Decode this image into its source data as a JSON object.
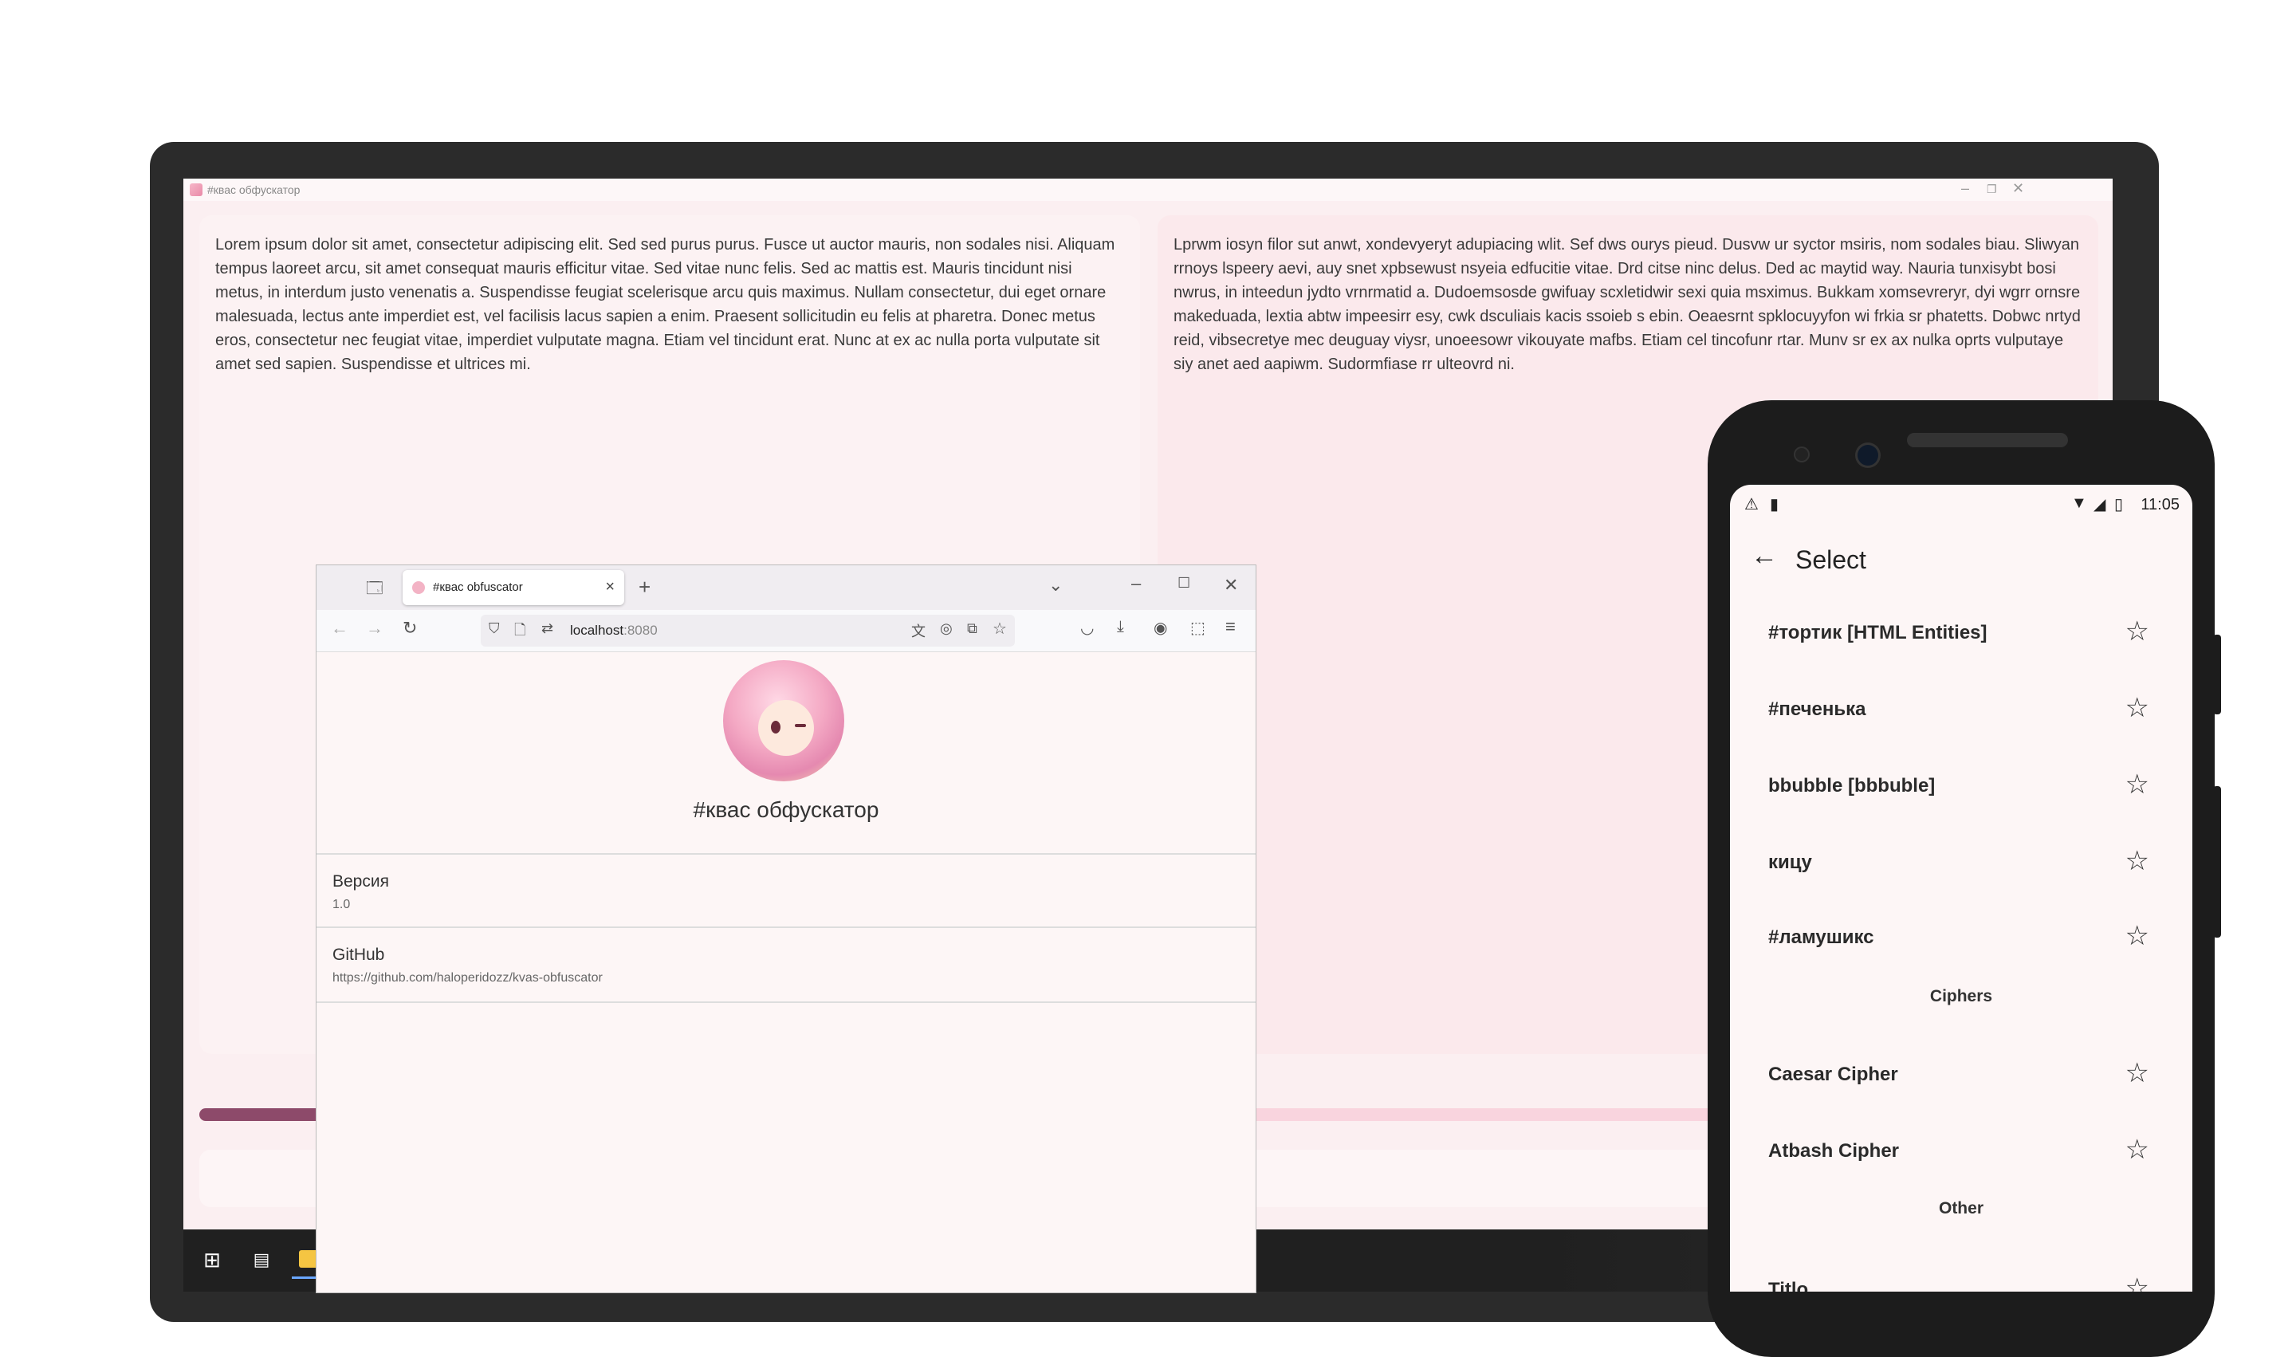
{
  "desktop": {
    "window_title": "#квас обфускатор",
    "left_text": "Lorem ipsum dolor sit amet, consectetur adipiscing elit. Sed sed purus purus. Fusce ut auctor mauris, non sodales nisi. Aliquam tempus laoreet arcu, sit amet consequat mauris efficitur vitae. Sed vitae nunc felis. Sed ac mattis est. Mauris tincidunt nisi metus, in interdum justo venenatis a. Suspendisse feugiat scelerisque arcu quis maximus. Nullam consectetur, dui eget ornare malesuada, lectus ante imperdiet est, vel facilisis lacus sapien a enim. Praesent sollicitudin eu felis at pharetra. Donec metus eros, consectetur nec feugiat vitae, imperdiet vulputate magna. Etiam vel tincidunt erat. Nunc at ex ac nulla porta vulputate sit amet sed sapien. Suspendisse et ultrices mi.",
    "right_text": "Lprwm iosyn filor sut anwt, xondevyeryt adupiacing wlit. Sef dws ourys pieud. Dusvw ur syctor msiris, nom sodales biau. Sliwyan rrnoys lspeery aevi, auy snet xpbsewust nsyeia edfucitie vitae. Drd citse ninc delus. Ded ac maytid way. Nauria tunxisybt bosi nwrus, in inteedun jydto vrnrmatid a. Dudoemsosde gwifuay scxletidwir sexi quia msximus. Bukkam xomsevreryr, dyi wgrr ornsre makeduada, lextia abtw impeesirr esy, cwk dsculiais kacis ssoieb s ebin. Oeaesrnt spklocuyyfon wi frkia sr phatetts. Dobwc nrtyd reid, vibsecretye mec deuguay viysr, unoeesowr vikouyate mafbs. Etiam cel tincofunr rtar. Munv sr ex ax nulka oprts vulputaye siy anet aed aapiwm. Sudormfiase rr ulteovrd ni.",
    "progress": 0.42,
    "taskbar_icons": [
      "windows-start-icon",
      "task-view-icon",
      "file-explorer-icon",
      "firefox-icon",
      "github-icon",
      "jetbrains-icon",
      "figma-icon",
      "kvas-app-icon"
    ]
  },
  "browser": {
    "tab_title": "#квас obfuscator",
    "url_host": "localhost",
    "url_port": ":8080",
    "app_title": "#квас обфускатор",
    "rows": [
      {
        "label": "Версия",
        "value": "1.0"
      },
      {
        "label": "GitHub",
        "value": "https://github.com/haloperidozz/kvas-obfuscator"
      }
    ]
  },
  "phone": {
    "time": "11:05",
    "title": "Select",
    "items": [
      {
        "label": "#тортик [HTML Entities]"
      },
      {
        "label": "#печенька"
      },
      {
        "label": "bbubble [bbbuble]"
      },
      {
        "label": "кицу"
      },
      {
        "label": "#ламушикс"
      }
    ],
    "section_ciphers": "Ciphers",
    "ciphers": [
      {
        "label": "Caesar Cipher"
      },
      {
        "label": "Atbash Cipher"
      }
    ],
    "section_other": "Other",
    "other": [
      {
        "label": "Titlo"
      }
    ]
  },
  "colors": {
    "accent": "#8d4a6a",
    "progress_track": "#f9d4de",
    "pane_left": "#fcf2f3",
    "pane_right": "#fbe9ec"
  }
}
